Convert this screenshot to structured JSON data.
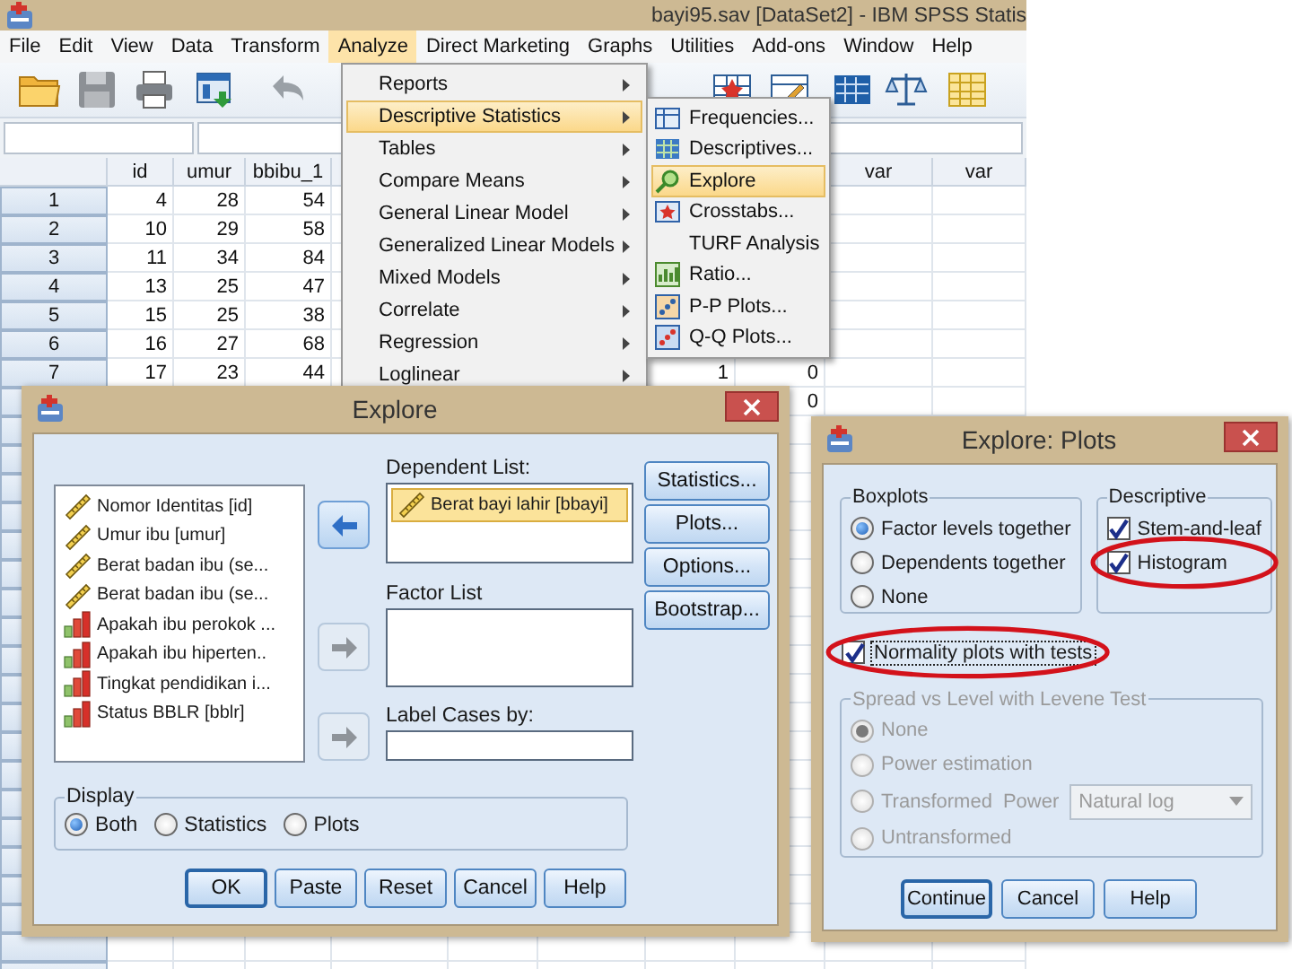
{
  "window": {
    "title": "bayi95.sav [DataSet2] - IBM SPSS Statis"
  },
  "menu_bar": [
    {
      "label": "File",
      "selected": false
    },
    {
      "label": "Edit",
      "selected": false
    },
    {
      "label": "View",
      "selected": false
    },
    {
      "label": "Data",
      "selected": false
    },
    {
      "label": "Transform",
      "selected": false
    },
    {
      "label": "Analyze",
      "selected": true
    },
    {
      "label": "Direct Marketing",
      "selected": false
    },
    {
      "label": "Graphs",
      "selected": false
    },
    {
      "label": "Utilities",
      "selected": false
    },
    {
      "label": "Add-ons",
      "selected": false
    },
    {
      "label": "Window",
      "selected": false
    },
    {
      "label": "Help",
      "selected": false
    }
  ],
  "data_grid": {
    "columns": [
      "id",
      "umur",
      "bbibu_1"
    ],
    "right_columns": [
      "var",
      "var"
    ],
    "rows": [
      {
        "number": "1",
        "cells": [
          "4",
          "28",
          "54"
        ]
      },
      {
        "number": "2",
        "cells": [
          "10",
          "29",
          "58"
        ]
      },
      {
        "number": "3",
        "cells": [
          "11",
          "34",
          "84"
        ]
      },
      {
        "number": "4",
        "cells": [
          "13",
          "25",
          "47"
        ]
      },
      {
        "number": "5",
        "cells": [
          "15",
          "25",
          "38"
        ]
      },
      {
        "number": "6",
        "cells": [
          "16",
          "27",
          "68"
        ]
      },
      {
        "number": "7",
        "cells": [
          "17",
          "23",
          "44"
        ],
        "far_cells": [
          "1",
          "0"
        ]
      },
      {
        "far_cells": [
          "0"
        ]
      }
    ]
  },
  "analyze_menu": {
    "items": [
      {
        "label": "Reports",
        "selected": false,
        "has_submenu": true
      },
      {
        "label": "Descriptive Statistics",
        "selected": true,
        "has_submenu": true
      },
      {
        "label": "Tables",
        "selected": false,
        "has_submenu": true
      },
      {
        "label": "Compare Means",
        "selected": false,
        "has_submenu": true
      },
      {
        "label": "General Linear Model",
        "selected": false,
        "has_submenu": true
      },
      {
        "label": "Generalized Linear Models",
        "selected": false,
        "has_submenu": true
      },
      {
        "label": "Mixed Models",
        "selected": false,
        "has_submenu": true
      },
      {
        "label": "Correlate",
        "selected": false,
        "has_submenu": true
      },
      {
        "label": "Regression",
        "selected": false,
        "has_submenu": true
      },
      {
        "label": "Loglinear",
        "selected": false,
        "has_submenu": true
      }
    ]
  },
  "descriptive_submenu": {
    "items": [
      {
        "label": "Frequencies...",
        "kind": "frequencies",
        "selected": false
      },
      {
        "label": "Descriptives...",
        "kind": "descriptives",
        "selected": false
      },
      {
        "label": "Explore",
        "kind": "explore",
        "selected": true
      },
      {
        "label": "Crosstabs...",
        "kind": "crosstabs",
        "selected": false
      },
      {
        "label": "TURF Analysis",
        "kind": "none",
        "selected": false
      },
      {
        "label": "Ratio...",
        "kind": "ratio",
        "selected": false
      },
      {
        "label": "P-P Plots...",
        "kind": "pp",
        "selected": false
      },
      {
        "label": "Q-Q Plots...",
        "kind": "qq",
        "selected": false
      }
    ]
  },
  "explore_dialog": {
    "title": "Explore",
    "variables": [
      {
        "label": "Nomor Identitas [id]",
        "kind": "scale"
      },
      {
        "label": "Umur ibu [umur]",
        "kind": "scale"
      },
      {
        "label": "Berat badan ibu (se...",
        "kind": "scale"
      },
      {
        "label": "Berat badan ibu (se...",
        "kind": "scale"
      },
      {
        "label": "Apakah ibu perokok ...",
        "kind": "nominal"
      },
      {
        "label": "Apakah ibu hiperten..",
        "kind": "nominal"
      },
      {
        "label": "Tingkat pendidikan i...",
        "kind": "nominal"
      },
      {
        "label": "Status BBLR [bblr]",
        "kind": "nominal"
      }
    ],
    "move_buttons": [
      {
        "kind": "left",
        "disabled": false
      },
      {
        "kind": "right",
        "disabled": true
      },
      {
        "kind": "right",
        "disabled": true
      }
    ],
    "dependent_list": {
      "label": "Dependent List:",
      "items": [
        {
          "label": "Berat bayi lahir [bbayi]",
          "kind": "scale",
          "selected": true
        }
      ]
    },
    "factor_list": {
      "label": "Factor List"
    },
    "label_cases": {
      "label": "Label Cases by:"
    },
    "side_buttons": [
      "Statistics...",
      "Plots...",
      "Options...",
      "Bootstrap..."
    ],
    "display": {
      "label": "Display",
      "options": [
        {
          "label": "Both",
          "selected": true
        },
        {
          "label": "Statistics",
          "selected": false
        },
        {
          "label": "Plots",
          "selected": false
        }
      ]
    },
    "buttons": [
      {
        "label": "OK",
        "default": true
      },
      {
        "label": "Paste",
        "default": false
      },
      {
        "label": "Reset",
        "default": false
      },
      {
        "label": "Cancel",
        "default": false
      },
      {
        "label": "Help",
        "default": false
      }
    ]
  },
  "plots_dialog": {
    "title": "Explore: Plots",
    "boxplots": {
      "label": "Boxplots",
      "options": [
        {
          "label": "Factor levels together",
          "selected": true
        },
        {
          "label": "Dependents together",
          "selected": false
        },
        {
          "label": "None",
          "selected": false
        }
      ]
    },
    "descriptive": {
      "label": "Descriptive",
      "options": [
        {
          "label": "Stem-and-leaf",
          "checked": true,
          "circled": false
        },
        {
          "label": "Histogram",
          "checked": true,
          "circled": true
        }
      ]
    },
    "normality": {
      "label": "Normality plots with tests",
      "checked": true,
      "circled": true,
      "focused": true
    },
    "spread": {
      "label": "Spread vs Level with Levene Test",
      "disabled": true,
      "options": [
        {
          "label": "None",
          "selected": true,
          "kind": "plain"
        },
        {
          "label": "Power estimation",
          "selected": false,
          "kind": "plain"
        },
        {
          "label": "Transformed",
          "selected": false,
          "kind": "transform"
        },
        {
          "label": "Untransformed",
          "selected": false,
          "kind": "plain"
        }
      ],
      "power": {
        "label": "Power",
        "value": "Natural log"
      }
    },
    "buttons": [
      {
        "label": "Continue",
        "default": true
      },
      {
        "label": "Cancel",
        "default": false
      },
      {
        "label": "Help",
        "default": false
      }
    ]
  }
}
